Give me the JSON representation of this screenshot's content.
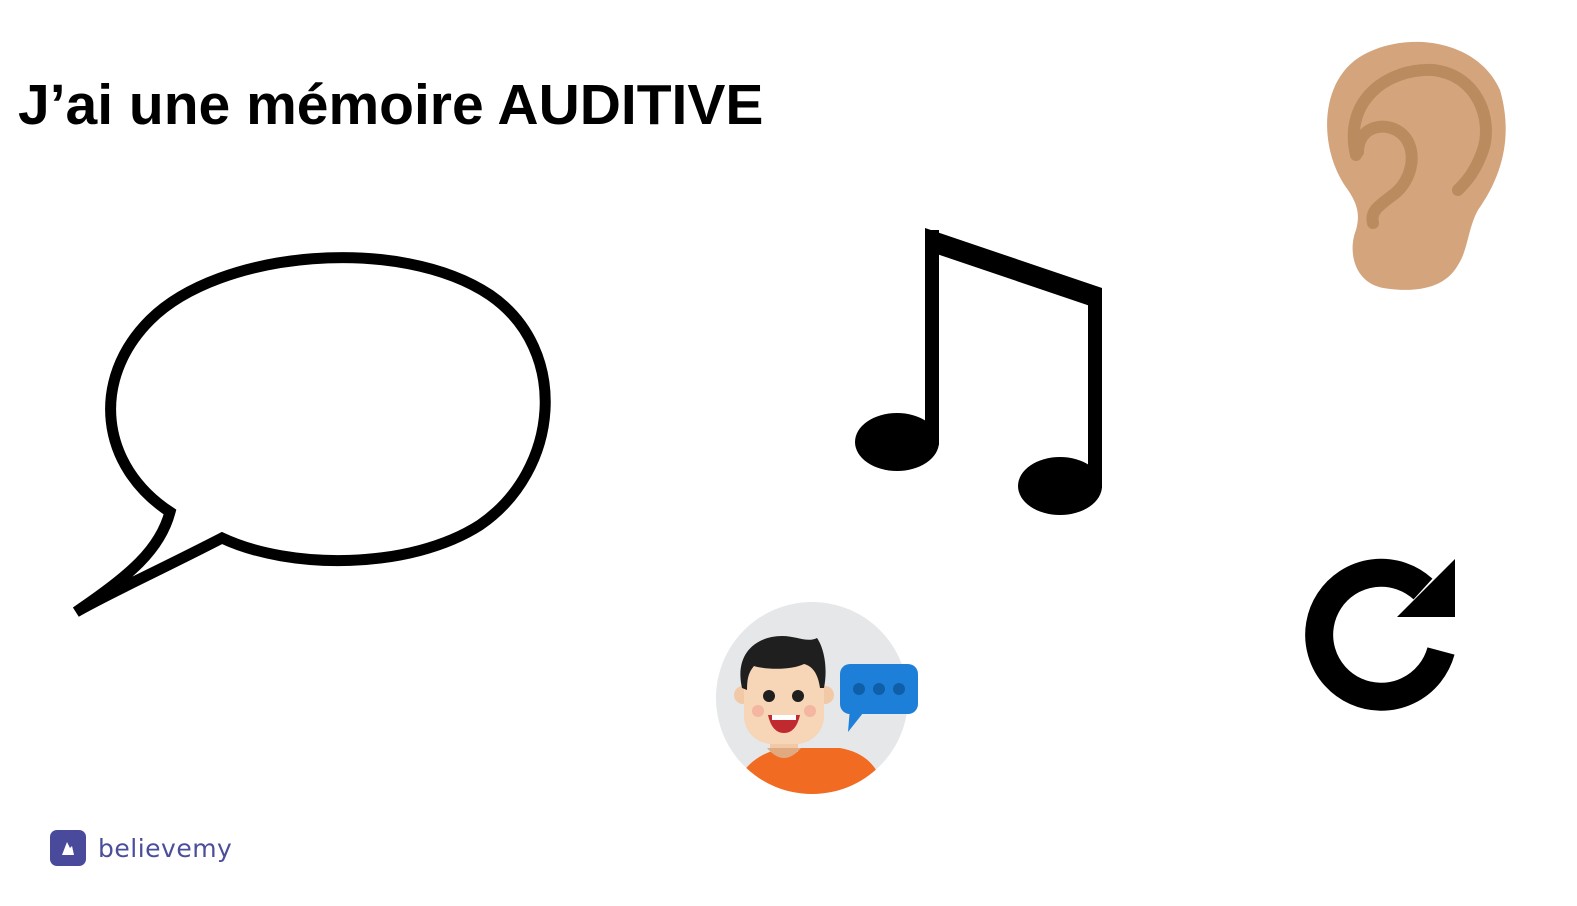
{
  "slide": {
    "title": "J’ai une mémoire AUDITIVE"
  },
  "icons": [
    "speech-bubble-icon",
    "music-note-icon",
    "ear-icon",
    "refresh-icon",
    "talking-person-icon"
  ],
  "brand": {
    "logo_text": "believemy",
    "logo_color": "#4a4a9c"
  },
  "colors": {
    "ear": "#d4a47c",
    "ear_detail": "#b98b5e",
    "chat_bubble": "#1e7fd9",
    "avatar_bg": "#e6e7e9",
    "shirt": "#f26b22"
  }
}
